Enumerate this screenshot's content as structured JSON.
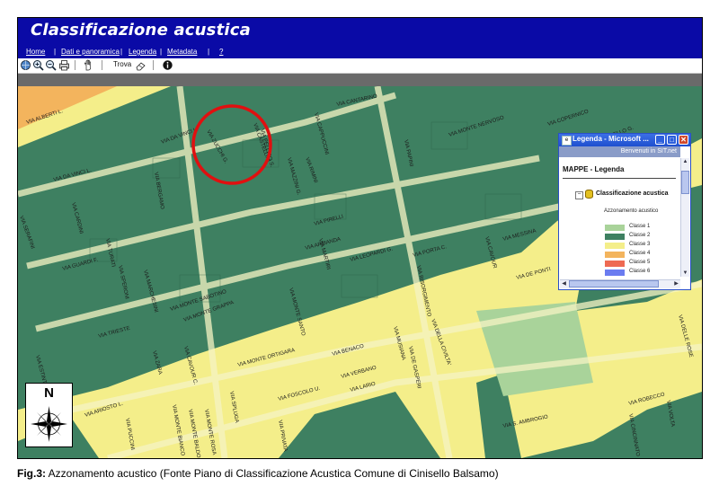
{
  "app": {
    "title": "Classificazione acustica",
    "nav": [
      "Home",
      "Dati e panoramica",
      "Legenda",
      "Metadata",
      "?"
    ],
    "toolbar": {
      "find_label": "Trova",
      "icons": [
        "pan-globe-icon",
        "zoom-in-icon",
        "zoom-out-icon",
        "print-icon",
        "hand-pan-icon",
        "eraser-icon",
        "info-icon"
      ]
    }
  },
  "map": {
    "streets": [
      "VIA ALBERTI L.",
      "VIA DA VINCI L.",
      "VIA DA VINCI L.",
      "VIA ZUCCHI G.",
      "VIA CASTELLINI",
      "VIA MAZZINI G.",
      "VIA CAPPUCCINI",
      "VIA PELLICO S.",
      "VIA RIMINI",
      "VIA PIRELLI",
      "VIA CANTARINO",
      "VIA PAPINI",
      "VIA MONTE NERVOSO",
      "VIA COPERNICO",
      "VIA PAIRELLO G.",
      "VIA SERAFINI",
      "VIA BERGAMO",
      "VIA CARDINI",
      "VIA TURATI",
      "VIA SPERONI",
      "VIA GUARDI F.",
      "VIA MARCHESINI",
      "VIA ARMANDA",
      "VIA LEOPARDI G.",
      "VIA MARTIRI",
      "VIA PORTA C.",
      "VIA MESSINA",
      "VIA DE PONTI",
      "VIA MONTE GRAPPA",
      "VIA MONTE SABOTINO",
      "VIA MONTE SANTO",
      "VIA RISORGIMENTO",
      "VIA DELLA CIVILTA'",
      "VIA CAVOUR",
      "VIA DELLE ROSE",
      "VIA ESTINTI",
      "VIA TRIESTE",
      "VIA ZARA",
      "VIA MONTE ORTIGARA",
      "VIA CAVOUR C.",
      "VIA BENACO",
      "VIA VERBANO",
      "VIA MUSIANA",
      "VIA DE GASPERI",
      "VIA LARIO",
      "VIA ROBECCO",
      "VIA ARIOSTO L.",
      "VIA FOSCOLO U.",
      "VIA MONTE BIANCO",
      "VIA MONTE BALDO",
      "VIA MONTE ROSA",
      "VIA SPLUGA",
      "VIA PRIVATA",
      "VIA S. AMBROGIO",
      "VIA PUCCINI",
      "VIA CINCINNATO",
      "VIA VOLTA"
    ]
  },
  "legend_window": {
    "title": "Legenda - Microsoft ...",
    "banner": "Benvenuti in SIT.net",
    "header": "MAPPE - Legenda",
    "tree_toggle": "−",
    "layer_name": "Classificazione acustica",
    "subtitle": "Azzonamento acustico",
    "classes": [
      {
        "label": "Classe 1",
        "color": "#a9d39a"
      },
      {
        "label": "Classe 2",
        "color": "#3e8061"
      },
      {
        "label": "Classe 3",
        "color": "#f4ee8a"
      },
      {
        "label": "Classe 4",
        "color": "#f3b45d"
      },
      {
        "label": "Classe 5",
        "color": "#ee6a53"
      },
      {
        "label": "Classe 6",
        "color": "#6b7cf0"
      }
    ],
    "buttons": {
      "minimize": "_",
      "maximize": "□",
      "close": "✕"
    }
  },
  "compass": {
    "label": "N"
  },
  "caption": {
    "prefix": "Fig.3:",
    "text": " Azzonamento acustico (Fonte Piano di Classificazione Acustica Comune di Cinisello Balsamo)"
  },
  "colors": {
    "header_blue": "#0a0aa6",
    "zone_green": "#3e8061",
    "zone_light_green": "#a9d39a",
    "zone_yellow": "#f4ee8a",
    "zone_orange": "#f3b45d",
    "highlight_circle": "#e01010"
  }
}
